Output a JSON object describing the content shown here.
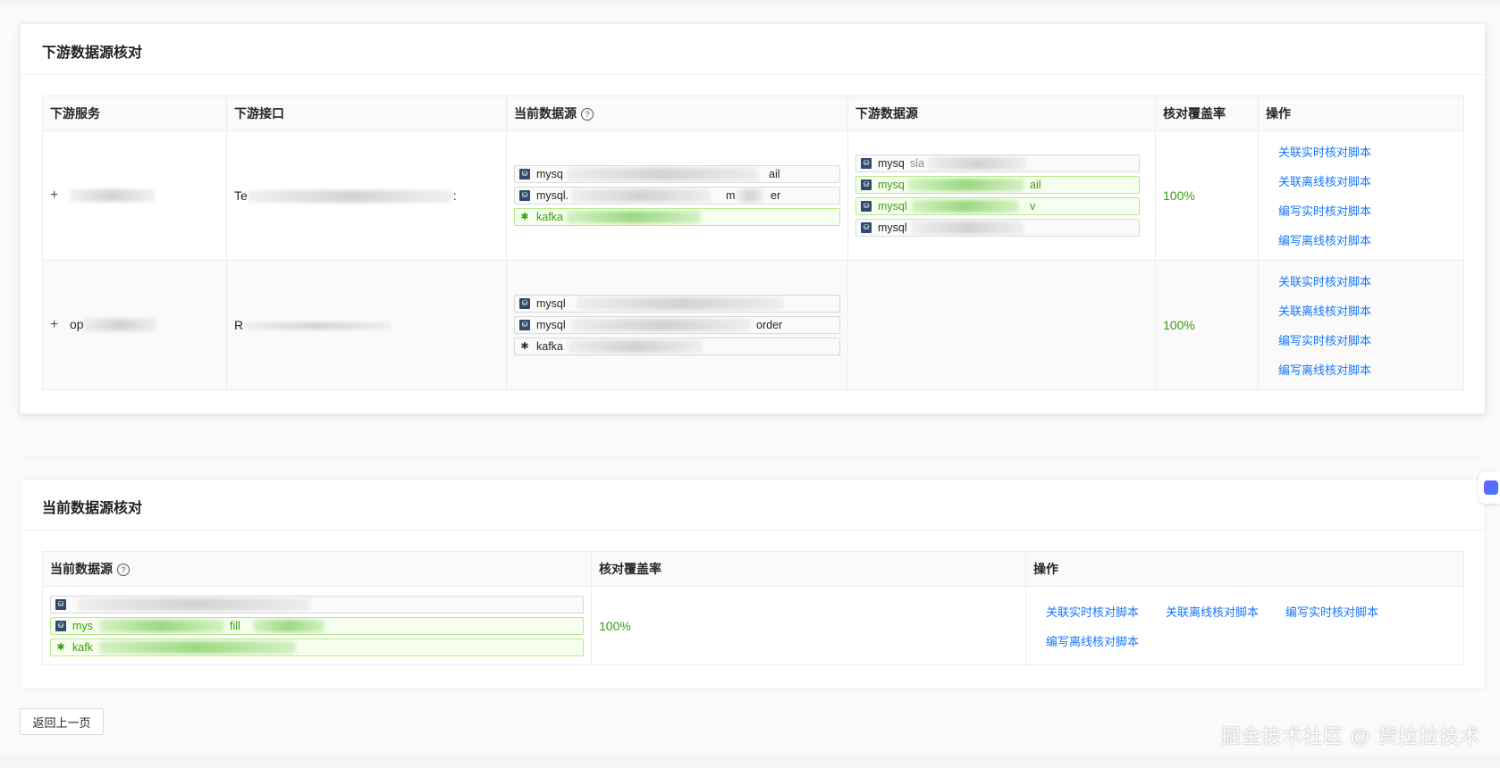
{
  "downstream_section": {
    "title": "下游数据源核对",
    "columns": [
      "下游服务",
      "下游接口",
      "当前数据源",
      "下游数据源",
      "核对覆盖率",
      "操作"
    ],
    "rows": [
      {
        "service": "",
        "interface": "Te",
        "current_sources": [
          {
            "type": "mysql",
            "text": "mysq",
            "tail": "ail",
            "status": "normal"
          },
          {
            "type": "mysql",
            "text": "mysql.",
            "tail": "m",
            "tail2": "er",
            "status": "normal"
          },
          {
            "type": "kafka",
            "text": "kafka",
            "tail": "",
            "status": "ok"
          }
        ],
        "downstream_sources": [
          {
            "type": "mysql",
            "text": "mysq",
            "tail": "sla",
            "status": "normal"
          },
          {
            "type": "mysql",
            "text": "mysq",
            "tail": "ail",
            "status": "ok"
          },
          {
            "type": "mysql",
            "text": "mysql",
            "tail": "v",
            "status": "ok"
          },
          {
            "type": "mysql",
            "text": "mysql",
            "tail": "",
            "status": "normal"
          }
        ],
        "coverage": "100%",
        "actions": [
          "关联实时核对脚本",
          "关联离线核对脚本",
          "编写实时核对脚本",
          "编写离线核对脚本"
        ]
      },
      {
        "service": "op",
        "interface": "R",
        "current_sources": [
          {
            "type": "mysql",
            "text": "mysql",
            "tail": "",
            "status": "normal"
          },
          {
            "type": "mysql",
            "text": "mysql",
            "tail": "order",
            "status": "normal"
          },
          {
            "type": "kafka",
            "text": "kafka",
            "tail": "",
            "status": "normal"
          }
        ],
        "downstream_sources": [],
        "coverage": "100%",
        "actions": [
          "关联实时核对脚本",
          "关联离线核对脚本",
          "编写实时核对脚本",
          "编写离线核对脚本"
        ]
      }
    ]
  },
  "current_section": {
    "title": "当前数据源核对",
    "columns": [
      "当前数据源",
      "核对覆盖率",
      "操作"
    ],
    "row": {
      "sources": [
        {
          "type": "mysql",
          "text": "",
          "tail": "",
          "status": "normal"
        },
        {
          "type": "mysql",
          "text": "mys",
          "tail": "fill",
          "status": "ok"
        },
        {
          "type": "kafka",
          "text": "kafk",
          "tail": "",
          "status": "ok"
        }
      ],
      "coverage": "100%",
      "actions": [
        "关联实时核对脚本",
        "关联离线核对脚本",
        "编写实时核对脚本",
        "编写离线核对脚本"
      ]
    }
  },
  "back_button": "返回上一页",
  "watermark": "掘金技术社区 @ 货拉拉技术",
  "colors": {
    "link": "#1677ff",
    "success": "#389e0d",
    "success_bg": "#f6ffed",
    "success_border": "#b7eb8f"
  }
}
